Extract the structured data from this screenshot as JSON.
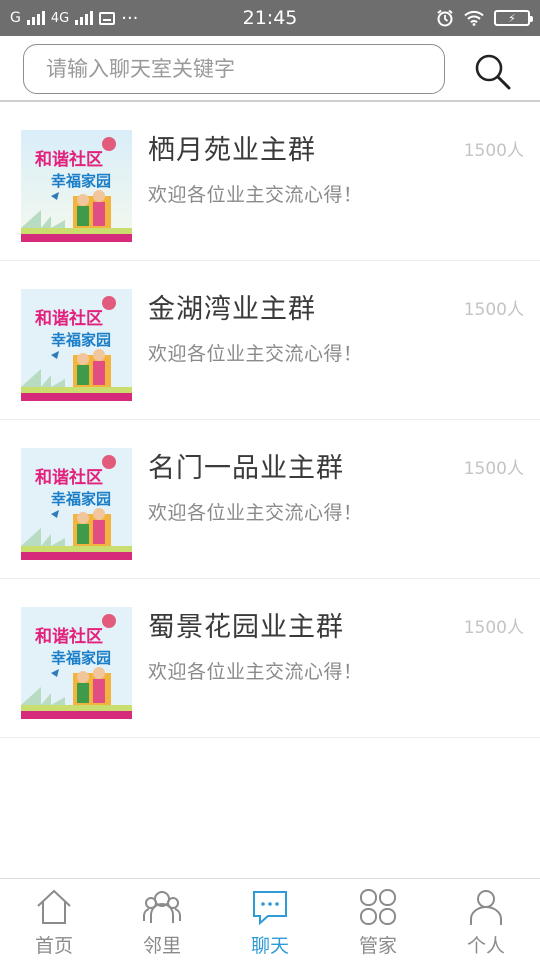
{
  "status_bar": {
    "carrier1": "G",
    "carrier2": "4G",
    "more": "···",
    "time": "21:45",
    "battery": "⚡",
    "icons": [
      "signal-icon",
      "message-icon",
      "alarm-icon",
      "wifi-icon",
      "battery-icon"
    ]
  },
  "search": {
    "placeholder": "请输入聊天室关键字",
    "value": "",
    "icon": "search-icon"
  },
  "thumbnail": {
    "line1": "和谐社区",
    "line2": "幸福家园"
  },
  "chats": [
    {
      "name": "栖月苑业主群",
      "subtitle": "欢迎各位业主交流心得！",
      "count": "1500人"
    },
    {
      "name": "金湖湾业主群",
      "subtitle": "欢迎各位业主交流心得！",
      "count": "1500人"
    },
    {
      "name": "名门一品业主群",
      "subtitle": "欢迎各位业主交流心得！",
      "count": "1500人"
    },
    {
      "name": "蜀景花园业主群",
      "subtitle": "欢迎各位业主交流心得！",
      "count": "1500人"
    }
  ],
  "nav": [
    {
      "label": "首页",
      "icon": "home-icon",
      "active": false
    },
    {
      "label": "邻里",
      "icon": "neighbors-icon",
      "active": false
    },
    {
      "label": "聊天",
      "icon": "chat-bubble-icon",
      "active": true
    },
    {
      "label": "管家",
      "icon": "grid-icon",
      "active": false
    },
    {
      "label": "个人",
      "icon": "person-icon",
      "active": false
    }
  ],
  "colors": {
    "status_bar": "#6e6e6e",
    "accent": "#2e9bd6",
    "inactive": "#8b8b8b"
  }
}
